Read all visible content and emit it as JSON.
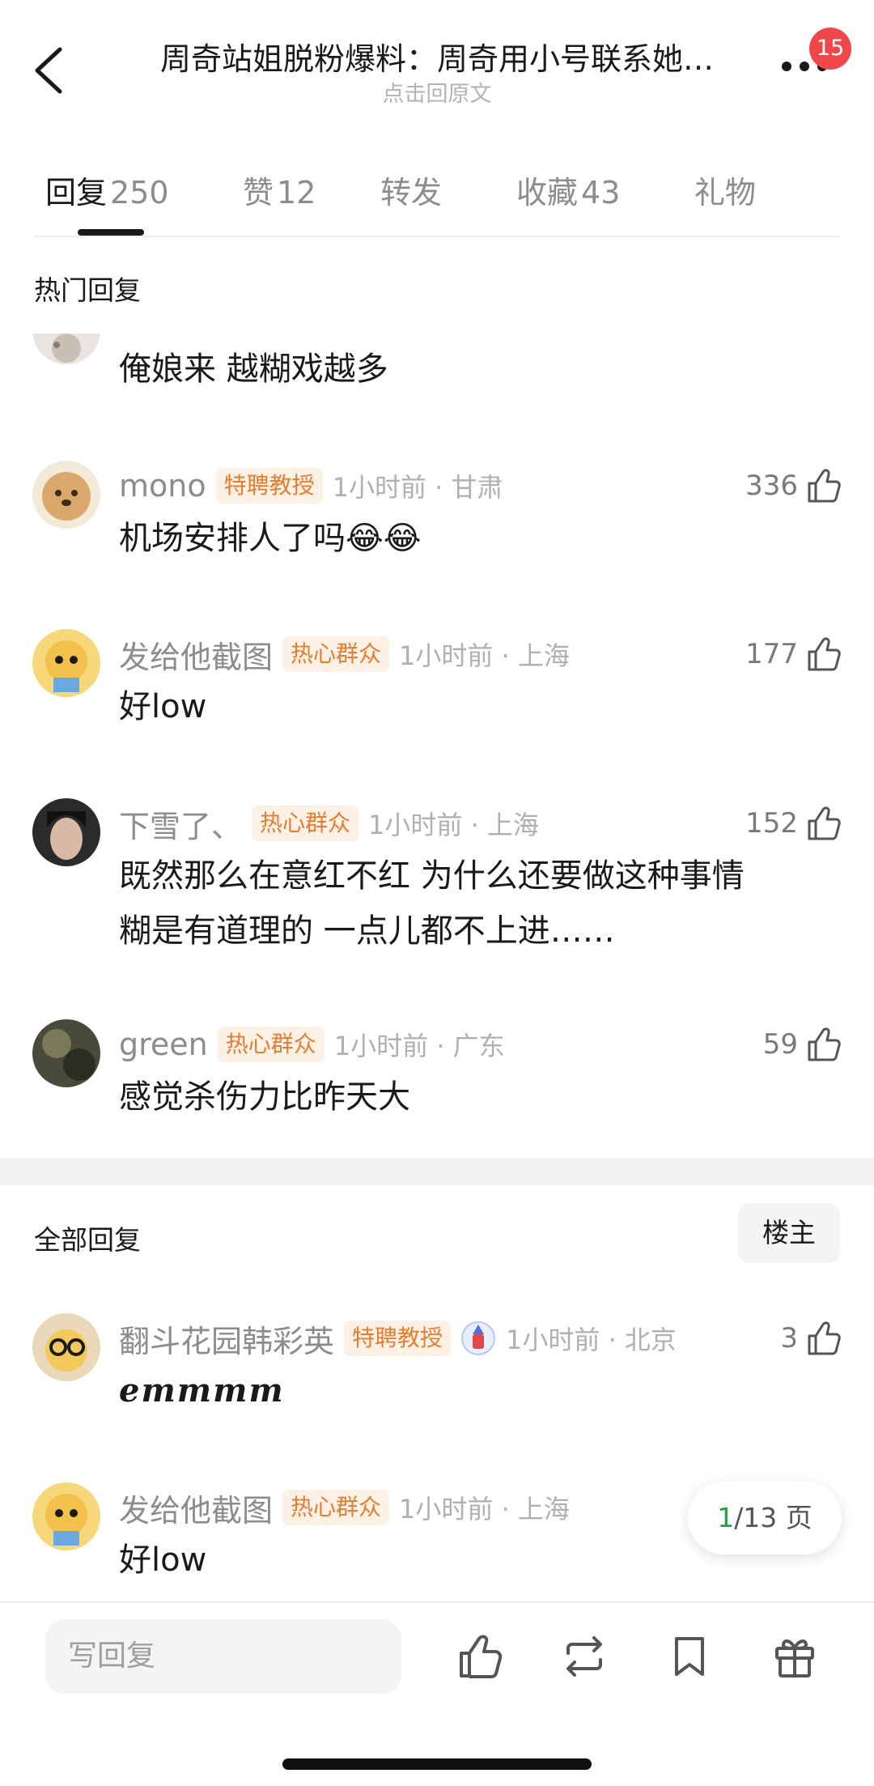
{
  "header": {
    "title": "周奇站姐脱粉爆料：周奇用小号联系她…",
    "subtitle": "点击回原文",
    "badge": "15"
  },
  "tabs": [
    {
      "label": "回复",
      "count": "250"
    },
    {
      "label": "赞",
      "count": "12"
    },
    {
      "label": "转发",
      "count": ""
    },
    {
      "label": "收藏",
      "count": "43"
    },
    {
      "label": "礼物",
      "count": ""
    }
  ],
  "hot_section": {
    "title": "热门回复"
  },
  "hot_comments": [
    {
      "username": "",
      "tag": "",
      "time": "",
      "likes": "",
      "text": [
        "俺娘来 越糊戏越多"
      ]
    },
    {
      "username": "mono",
      "tag": "特聘教授",
      "time": "1小时前 · 甘肃",
      "likes": "336",
      "text": [
        "机场安排人了吗😂😂"
      ]
    },
    {
      "username": "发给他截图",
      "tag": "热心群众",
      "time": "1小时前 · 上海",
      "likes": "177",
      "text": [
        "好low"
      ]
    },
    {
      "username": "下雪了、",
      "tag": "热心群众",
      "time": "1小时前 · 上海",
      "likes": "152",
      "text": [
        "既然那么在意红不红 为什么还要做这种事情",
        "糊是有道理的 一点儿都不上进……"
      ]
    },
    {
      "username": "green",
      "tag": "热心群众",
      "time": "1小时前 · 广东",
      "likes": "59",
      "text": [
        "感觉杀伤力比昨天大"
      ]
    }
  ],
  "all_section": {
    "title": "全部回复",
    "filter_button": "楼主"
  },
  "all_comments": [
    {
      "username": "翻斗花园韩彩英",
      "tag": "特聘教授",
      "time": "1小时前 · 北京",
      "likes": "3",
      "text": [
        "emmmm"
      ]
    },
    {
      "username": "发给他截图",
      "tag": "热心群众",
      "time": "1小时前 · 上海",
      "likes": "",
      "text": [
        "好low"
      ]
    }
  ],
  "pagination": {
    "current": "1",
    "rest": "/13 页"
  },
  "bottom_bar": {
    "reply_placeholder": "写回复"
  },
  "colors": {
    "accent_tag_bg": "#fdf0e4",
    "accent_tag_text": "#e37e33",
    "badge": "#f0474b",
    "page_current": "#2a9d4a"
  },
  "icons": [
    "back-icon",
    "more-icon",
    "like-icon",
    "repost-icon",
    "bookmark-icon",
    "gift-icon"
  ]
}
